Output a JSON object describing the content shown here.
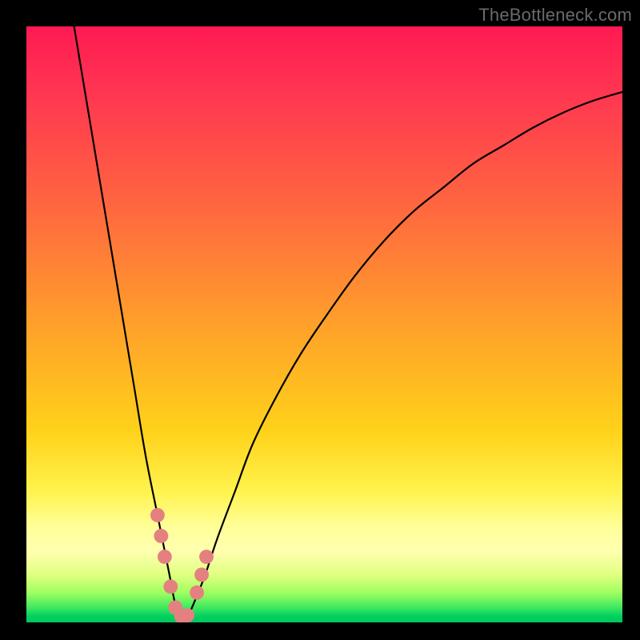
{
  "watermark": "TheBottleneck.com",
  "chart_data": {
    "type": "line",
    "title": "",
    "xlabel": "",
    "ylabel": "",
    "xlim": [
      0,
      100
    ],
    "ylim": [
      0,
      100
    ],
    "series": [
      {
        "name": "bottleneck-curve",
        "x": [
          8,
          10,
          12,
          14,
          16,
          18,
          20,
          22,
          24,
          25,
          26,
          27,
          28,
          30,
          32,
          35,
          38,
          42,
          46,
          50,
          55,
          60,
          65,
          70,
          75,
          80,
          85,
          90,
          95,
          100
        ],
        "y": [
          100,
          88,
          76,
          64,
          52,
          40,
          28,
          18,
          8,
          3,
          1,
          1,
          3,
          8,
          14,
          22,
          30,
          38,
          45,
          51,
          58,
          64,
          69,
          73,
          77,
          80,
          83,
          85.5,
          87.5,
          89
        ]
      }
    ],
    "markers": {
      "name": "highlighted-points",
      "color": "#e58080",
      "points": [
        {
          "x": 22.0,
          "y": 18.0,
          "r": 1.6
        },
        {
          "x": 22.6,
          "y": 14.5,
          "r": 1.6
        },
        {
          "x": 23.2,
          "y": 11.0,
          "r": 1.6
        },
        {
          "x": 24.2,
          "y": 6.0,
          "r": 1.6
        },
        {
          "x": 25.0,
          "y": 2.5,
          "r": 1.6
        },
        {
          "x": 26.0,
          "y": 1.0,
          "r": 1.6
        },
        {
          "x": 27.0,
          "y": 1.2,
          "r": 1.6
        },
        {
          "x": 28.6,
          "y": 5.0,
          "r": 1.6
        },
        {
          "x": 29.4,
          "y": 8.0,
          "r": 1.6
        },
        {
          "x": 30.2,
          "y": 11.0,
          "r": 1.6
        }
      ]
    }
  }
}
